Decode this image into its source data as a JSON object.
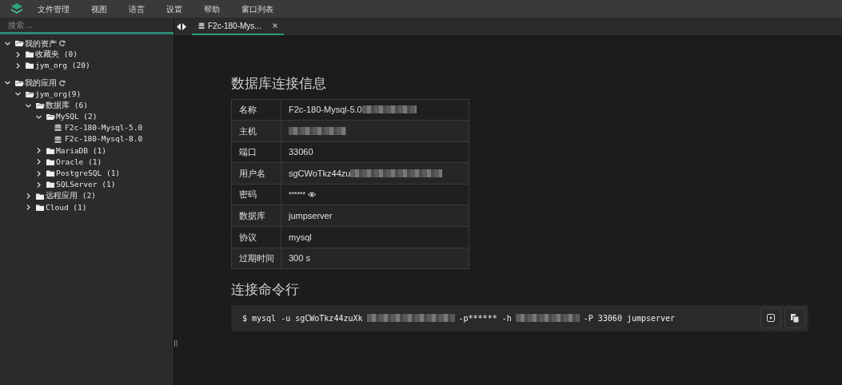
{
  "menu": [
    "文件管理",
    "视图",
    "语言",
    "设置",
    "帮助",
    "窗口列表"
  ],
  "search": {
    "placeholder": "搜索 ..."
  },
  "tree": [
    {
      "label": "我的资产",
      "kind": "root",
      "expanded": true,
      "children": [
        {
          "label": "收藏夹 (0)",
          "kind": "folder",
          "expanded": false
        },
        {
          "label": "jym_org (20)",
          "kind": "folder",
          "expanded": false
        }
      ]
    },
    {
      "label": "我的应用",
      "kind": "root",
      "expanded": true,
      "children": [
        {
          "label": "jym_org(9)",
          "kind": "folder",
          "expanded": true,
          "children": [
            {
              "label": "数据库 (6)",
              "kind": "folder",
              "expanded": true,
              "children": [
                {
                  "label": "MySQL (2)",
                  "kind": "folder",
                  "expanded": true,
                  "children": [
                    {
                      "label": "F2c-180-Mysql-5.0",
                      "kind": "database"
                    },
                    {
                      "label": "F2c-180-Mysql-8.0",
                      "kind": "database"
                    }
                  ]
                },
                {
                  "label": "MariaDB (1)",
                  "kind": "folder",
                  "expanded": false
                },
                {
                  "label": "Oracle (1)",
                  "kind": "folder",
                  "expanded": false
                },
                {
                  "label": "PostgreSQL (1)",
                  "kind": "folder",
                  "expanded": false
                },
                {
                  "label": "SQLServer (1)",
                  "kind": "folder",
                  "expanded": false
                }
              ]
            },
            {
              "label": "远程应用 (2)",
              "kind": "folder",
              "expanded": false
            },
            {
              "label": "Cloud (1)",
              "kind": "folder",
              "expanded": false
            }
          ]
        }
      ]
    }
  ],
  "tabs": [
    {
      "label": "F2c-180-Mys...",
      "selected": true
    }
  ],
  "info": {
    "title": "数据库连接信息",
    "rows": [
      {
        "label": "名称",
        "value": "F2c-180-Mysql-5.0",
        "redacted": true
      },
      {
        "label": "主机",
        "redacted": true
      },
      {
        "label": "端口",
        "value": "33060"
      },
      {
        "label": "用户名",
        "value": "sgCWoTkz44zu",
        "redacted": true
      },
      {
        "label": "密码",
        "value": "******",
        "kind": "password"
      },
      {
        "label": "数据库",
        "value": "jumpserver"
      },
      {
        "label": "协议",
        "value": "mysql"
      },
      {
        "label": "过期时间",
        "value": "300 s"
      }
    ]
  },
  "command": {
    "title": "连接命令行",
    "parts": [
      {
        "text": "$ mysql -u sgCWoTkz44zuXk",
        "redacted": true
      },
      {
        "text": "-p****** -h",
        "redacted": true
      },
      {
        "text": "-P 33060 jumpserver"
      }
    ]
  }
}
